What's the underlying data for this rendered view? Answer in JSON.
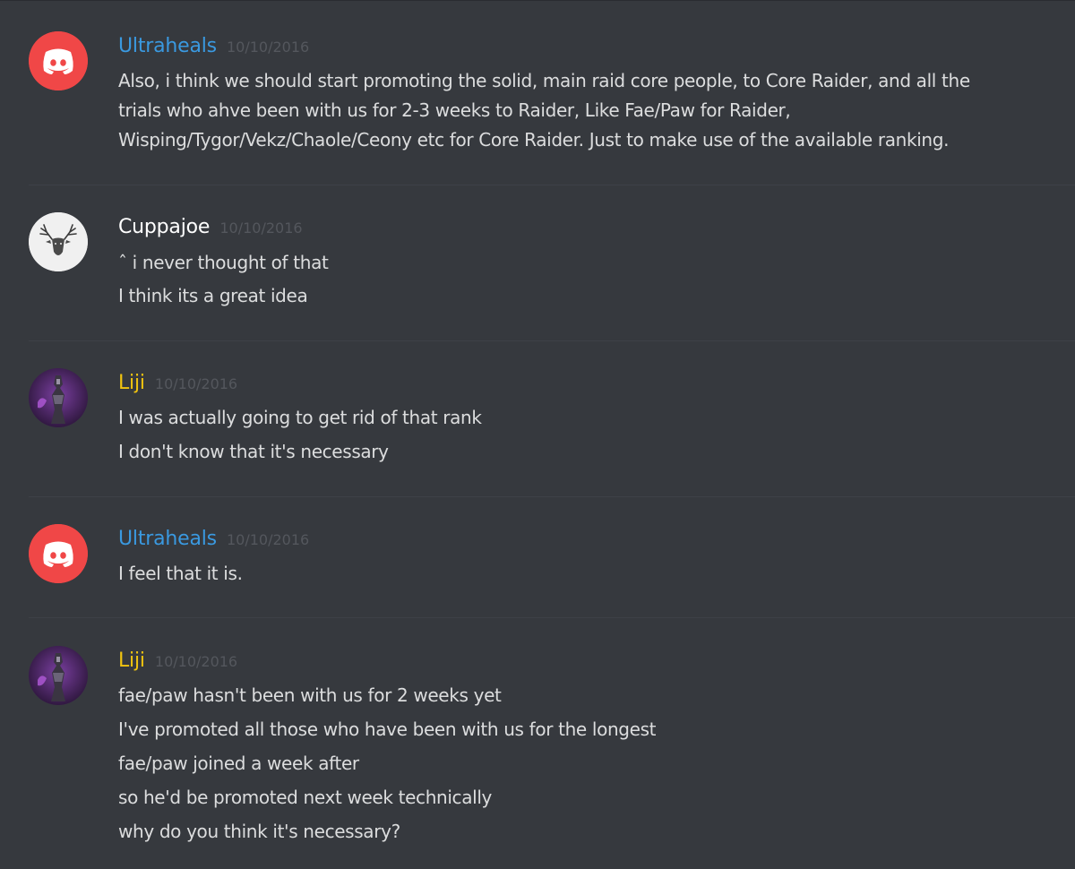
{
  "colors": {
    "background": "#36393e",
    "divider": "#3e4147",
    "ultraheals_name": "#3a99e0",
    "cuppajoe_name": "#ffffff",
    "liji_name": "#f1c40f",
    "timestamp": "#54575d",
    "discord_logo_bg": "#f04747"
  },
  "messages": [
    {
      "username": "Ultraheals",
      "timestamp": "10/10/2016",
      "avatar_icon": "discord-logo-icon",
      "lines": [
        "Also, i think we should start promoting the solid, main raid core people, to Core Raider, and all the",
        "trials who ahve been with us for 2-3 weeks to Raider, Like Fae/Paw for Raider,",
        "Wisping/Tygor/Vekz/Chaole/Ceony etc for Core Raider. Just to make use of the available ranking."
      ]
    },
    {
      "username": "Cuppajoe",
      "timestamp": "10/10/2016",
      "avatar_icon": "stag-head-icon",
      "lines": [
        "ˆ i never thought of that",
        "I think its a great idea"
      ]
    },
    {
      "username": "Liji",
      "timestamp": "10/10/2016",
      "avatar_icon": "character-portrait-icon",
      "lines": [
        "I was actually going to get rid of that rank",
        "I don't know that it's necessary"
      ]
    },
    {
      "username": "Ultraheals",
      "timestamp": "10/10/2016",
      "avatar_icon": "discord-logo-icon",
      "lines": [
        "I feel that it is."
      ]
    },
    {
      "username": "Liji",
      "timestamp": "10/10/2016",
      "avatar_icon": "character-portrait-icon",
      "lines": [
        "fae/paw hasn't been with us for 2 weeks yet",
        "I've promoted all those who have been with us for the longest",
        "fae/paw joined a week after",
        "so he'd be promoted next week technically",
        "why do you think it's necessary?"
      ]
    }
  ]
}
